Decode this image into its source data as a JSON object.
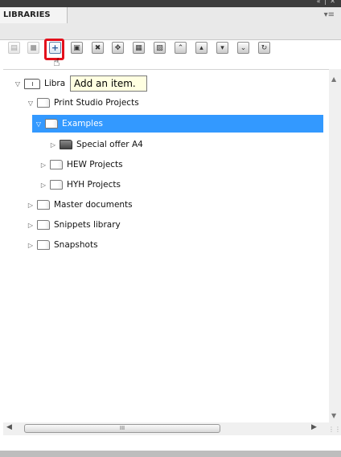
{
  "window": {
    "controls": "« | ✕"
  },
  "panel": {
    "title": "LIBRARIES",
    "menu_icon": "panel-menu-icon",
    "menu_glyph": "▾≡"
  },
  "toolbar": {
    "buttons": [
      {
        "icon": "new-library-icon",
        "glyph": "▤",
        "disabled": true
      },
      {
        "icon": "save-icon",
        "glyph": "■",
        "disabled": true
      },
      {
        "icon": "add-item-icon",
        "glyph": "+",
        "active": true
      },
      {
        "icon": "add-file-icon",
        "glyph": "▣"
      },
      {
        "icon": "delete-icon",
        "glyph": "✖"
      },
      {
        "icon": "import-icon",
        "glyph": "✥"
      },
      {
        "icon": "properties-icon",
        "glyph": "▦"
      },
      {
        "icon": "library-properties-icon",
        "glyph": "▨"
      },
      {
        "icon": "collapse-icon",
        "glyph": "⌃"
      },
      {
        "icon": "move-up-icon",
        "glyph": "▴"
      },
      {
        "icon": "move-down-icon",
        "glyph": "▾"
      },
      {
        "icon": "expand-icon",
        "glyph": "⌄"
      },
      {
        "icon": "refresh-icon",
        "glyph": "↻"
      }
    ]
  },
  "tooltip": {
    "text": "Add an item."
  },
  "tree": {
    "root_label": "Libra",
    "items": [
      {
        "label": "Print Studio Projects",
        "expanded": true
      },
      {
        "label": "Examples",
        "expanded": true,
        "selected": true
      },
      {
        "label": "Special offer A4"
      },
      {
        "label": "HEW Projects"
      },
      {
        "label": "HYH Projects"
      },
      {
        "label": "Master documents"
      },
      {
        "label": "Snippets library"
      },
      {
        "label": "Snapshots"
      }
    ]
  },
  "hscroll": {
    "thumb_glyph": "III"
  }
}
